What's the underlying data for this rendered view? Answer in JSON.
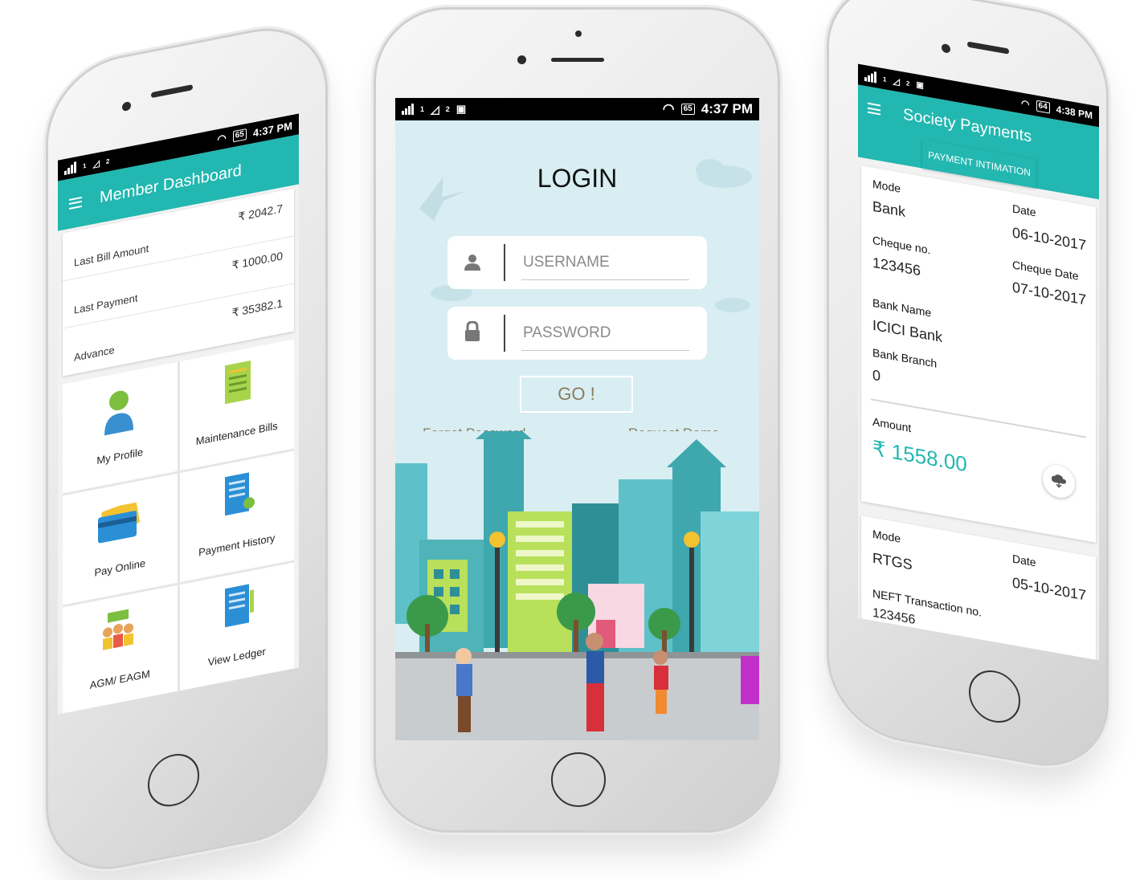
{
  "status_bar": {
    "sim1": "1",
    "sim2": "2",
    "battery": "65",
    "battery_right": "64",
    "time": "4:37 PM",
    "time_right": "4:38 PM"
  },
  "dashboard": {
    "title": "Member Dashboard",
    "summary": [
      {
        "label": "Last Bill Amount",
        "value": "₹ 2042.7"
      },
      {
        "label": "Last Payment",
        "value": "₹ 1000.00"
      },
      {
        "label": "Advance",
        "value": "₹ 35382.1"
      }
    ],
    "tiles": [
      {
        "label": "My Profile",
        "icon": "profile-icon"
      },
      {
        "label": "Maintenance Bills",
        "icon": "bill-icon"
      },
      {
        "label": "Pay Online",
        "icon": "card-icon"
      },
      {
        "label": "Payment History",
        "icon": "history-icon"
      },
      {
        "label": "AGM/ EAGM",
        "icon": "meeting-icon"
      },
      {
        "label": "View Ledger",
        "icon": "ledger-icon"
      }
    ]
  },
  "login": {
    "title": "LOGIN",
    "username_placeholder": "USERNAME",
    "password_placeholder": "PASSWORD",
    "go_label": "GO !",
    "forgot_label": "Forgot Password",
    "demo_label": "Request Demo"
  },
  "payments": {
    "title": "Society Payments",
    "tab_label": "PAYMENT INTIMATION",
    "entry1": {
      "mode_label": "Mode",
      "mode": "Bank",
      "date_label": "Date",
      "date": "06-10-2017",
      "cheque_no_label": "Cheque no.",
      "cheque_no": "123456",
      "cheque_date_label": "Cheque Date",
      "cheque_date": "07-10-2017",
      "bank_name_label": "Bank Name",
      "bank_name": "ICICI Bank",
      "bank_branch_label": "Bank Branch",
      "bank_branch": "0",
      "amount_label": "Amount",
      "amount": "₹ 1558.00"
    },
    "entry2": {
      "mode_label": "Mode",
      "mode": "RTGS",
      "date_label": "Date",
      "date": "05-10-2017",
      "neft_label": "NEFT Transaction no.",
      "neft": "123456"
    }
  },
  "colors": {
    "accent": "#22b7b0",
    "sky": "#d8eef3",
    "link": "#8a7a5c"
  }
}
